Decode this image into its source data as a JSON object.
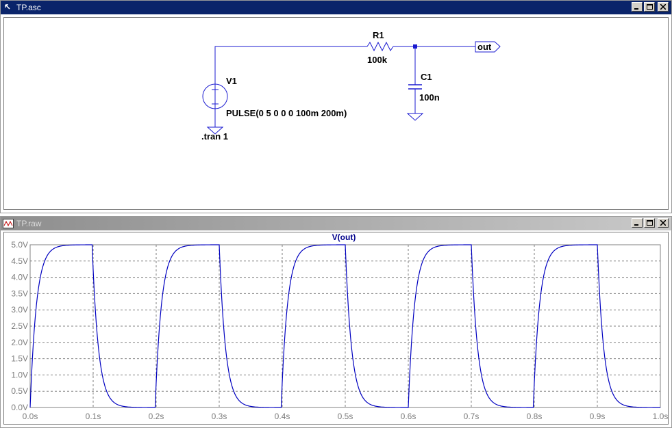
{
  "schematic_window": {
    "title": "TP.asc",
    "components": {
      "r1_name": "R1",
      "r1_value": "100k",
      "c1_name": "C1",
      "c1_value": "100n",
      "v1_name": "V1",
      "v1_value": "PULSE(0 5 0 0 0 100m 200m)",
      "net_label": "out",
      "directive": ".tran 1"
    }
  },
  "waveform_window": {
    "title": "TP.raw"
  },
  "chart_data": {
    "type": "line",
    "title": "V(out)",
    "xlabel": "",
    "ylabel": "",
    "xlim": [
      0,
      1.0
    ],
    "ylim": [
      0,
      5.0
    ],
    "x_ticks": [
      "0.0s",
      "0.1s",
      "0.2s",
      "0.3s",
      "0.4s",
      "0.5s",
      "0.6s",
      "0.7s",
      "0.8s",
      "0.9s",
      "1.0s"
    ],
    "y_ticks": [
      "0.0V",
      "0.5V",
      "1.0V",
      "1.5V",
      "2.0V",
      "2.5V",
      "3.0V",
      "3.5V",
      "4.0V",
      "4.5V",
      "5.0V"
    ],
    "grid": true,
    "series_color": "#0000c0",
    "series": [
      {
        "name": "V(out)",
        "source": "PULSE(0 5 0 0 0 100m 200m)",
        "tau_s": 0.01,
        "samples": 600
      }
    ]
  }
}
